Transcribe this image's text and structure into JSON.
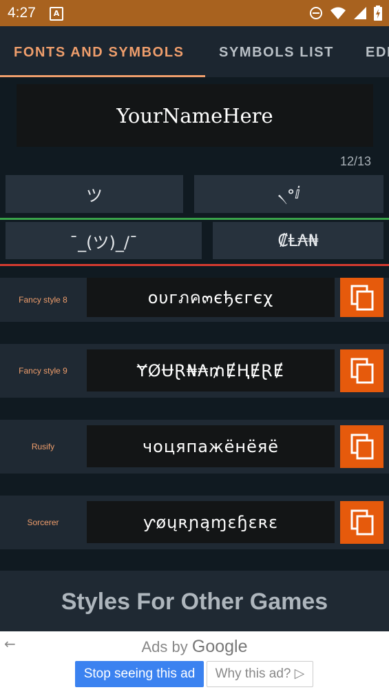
{
  "status_bar": {
    "time": "4:27",
    "notification_icon": "A"
  },
  "tabs": [
    {
      "label": "FONTS AND SYMBOLS"
    },
    {
      "label": "SYMBOLS LIST"
    },
    {
      "label": "EDI"
    }
  ],
  "name_input": {
    "value": "YourNameHere"
  },
  "pager": {
    "counter": "12/13"
  },
  "symbol_buttons": [
    {
      "label": "ツ"
    },
    {
      "label": "৲॰ⅈ"
    },
    {
      "label": "¯_(ツ)_/¯"
    },
    {
      "label": "₡Ⱡ₳₦"
    }
  ],
  "styles": [
    {
      "name": "Fancy style 8",
      "text": "oυгภค๓єђєгєχ"
    },
    {
      "name": "Fancy style 9",
      "text": "ɎØɄⱤ₦₳₥ɆⱧɆⱤɆ"
    },
    {
      "name": "Rusify",
      "text": "чоцяпажёнёяё"
    },
    {
      "name": "Sorcerer",
      "text": "ƴøųʀɲąɱɛɧɛʀɛ"
    }
  ],
  "section": {
    "title": "Styles For Other Games"
  },
  "ad": {
    "ads_by": "Ads by",
    "brand": "Google",
    "stop_label": "Stop seeing this ad",
    "why_label": "Why this ad?"
  },
  "colors": {
    "accent": "#ef9e6c",
    "copy_button": "#e65a0c",
    "status_bar": "#a8621f",
    "divider_green": "#3aa34a",
    "divider_red": "#d63b2f"
  }
}
